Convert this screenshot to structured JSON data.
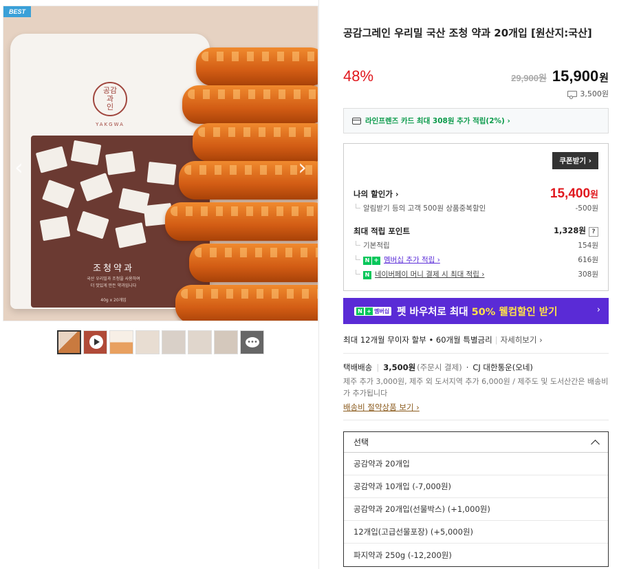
{
  "gallery": {
    "badge": "BEST",
    "pouch_logo": "공감\n과\n인",
    "pouch_brand": "YAKGWA",
    "pouch_title": "조청약과",
    "pouch_sub_1": "국산 우리밀과 조청을 사용하여",
    "pouch_sub_2": "더 맛있게 만든 약과입니다",
    "pouch_weight": "40g x 20개입",
    "prev_icon": "chevron-left-icon",
    "next_icon": "chevron-right-icon",
    "thumbs": [
      {
        "kind": "image",
        "color": "#c97a3f",
        "active": true
      },
      {
        "kind": "video",
        "color": "#b04a38"
      },
      {
        "kind": "image",
        "color": "#f2e4d4"
      },
      {
        "kind": "image",
        "color": "#e8ddd2"
      },
      {
        "kind": "image",
        "color": "#d9d0c8"
      },
      {
        "kind": "image",
        "color": "#e0d6cc"
      },
      {
        "kind": "image",
        "color": "#d4c8bc"
      },
      {
        "kind": "more",
        "icon": "chat-more-icon",
        "label": "•••"
      }
    ]
  },
  "product": {
    "title": "공감그레인 우리밀 국산 조청 약과 20개입 [원산지:국산]",
    "discount_rate": "48%",
    "original_price": "29,900원",
    "sale_price": "15,900",
    "sale_unit": "원",
    "shipping_fee": "3,500원"
  },
  "card_benefit": {
    "text": "라인프렌즈 카드 최대 308원 추가 적립(2%) ›"
  },
  "benefits": {
    "coupon_button": "쿠폰받기 ›",
    "my_price_label": "나의 할인가 ›",
    "my_price_value": "15,400",
    "my_price_unit": "원",
    "alert_label": "알림받기 등의 고객 500원 상품중복할인",
    "alert_value": "-500원",
    "max_point_label": "최대 적립 포인트",
    "max_point_value": "1,328원",
    "qmark": "?",
    "basic_label": "기본적립",
    "basic_value": "154원",
    "membership_label": "멤버십 추가 적립 ›",
    "membership_value": "616원",
    "npay_label": "네이버페이 머니 결제 시 최대 적립 ›",
    "npay_value": "308원",
    "n_char": "N",
    "plus_char": "+"
  },
  "promo": {
    "tag": "멤버십",
    "text_before": "펫 바우처로 최대 ",
    "highlight": "50% 웰컴할인 받기",
    "arrow": "›",
    "brand_color": "#5a2bd6"
  },
  "installment": {
    "text": "최대 12개월 무이자 할부 • 60개월 특별금리",
    "link": "자세히보기 ›"
  },
  "shipping": {
    "method": "택배배송",
    "fee": "3,500원",
    "fee_note": "(주문시 결제)",
    "carrier": "CJ 대한통운(오네)",
    "desc": "제주 추가 3,000원, 제주 외 도서지역 추가 6,000원 / 제주도 및 도서산간은 배송비가 추가됩니다",
    "link": "배송비 절약상품 보기 ›"
  },
  "select": {
    "placeholder": "선택",
    "options": [
      "공감약과 20개입",
      "공감약과 10개입 (-7,000원)",
      "공감약과 20개입(선물박스) (+1,000원)",
      "12개입(고급선물포장) (+5,000원)",
      "파지약과 250g (-12,200원)"
    ]
  }
}
